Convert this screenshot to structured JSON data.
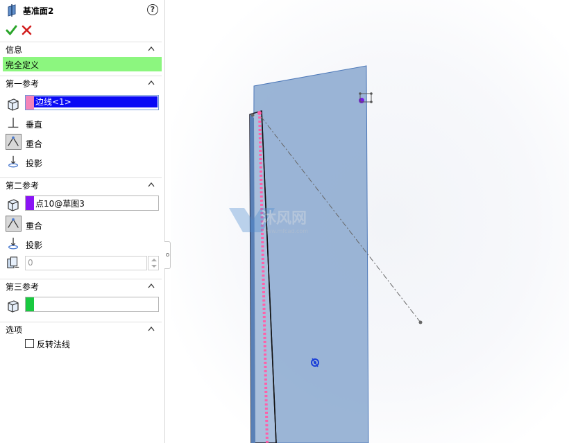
{
  "feature": {
    "title": "基准面2",
    "help": "?"
  },
  "sections": {
    "info": {
      "header": "信息",
      "status": "完全定义"
    },
    "first_ref": {
      "header": "第一参考",
      "selection": "边线<1>",
      "swatch_color": "#f484b9",
      "options": [
        "垂直",
        "重合",
        "投影"
      ]
    },
    "second_ref": {
      "header": "第二参考",
      "selection": "点10@草图3",
      "swatch_color": "#8a14f5",
      "options": [
        "重合",
        "投影"
      ],
      "count_value": "0"
    },
    "third_ref": {
      "header": "第三参考",
      "selection": "",
      "swatch_color": "#19c940"
    },
    "options": {
      "header": "选项",
      "flip_normal": "反转法线",
      "flip_checked": false
    }
  },
  "watermark": {
    "text": "沐风网",
    "url": "www.mfcad.com"
  },
  "colors": {
    "status_bg": "#8cf67f",
    "selection_highlight": "#0a0af5",
    "plane_fill": "#8aa8cf",
    "edge_highlight": "#ff5fa8",
    "point_marker": "#7a1be0"
  }
}
